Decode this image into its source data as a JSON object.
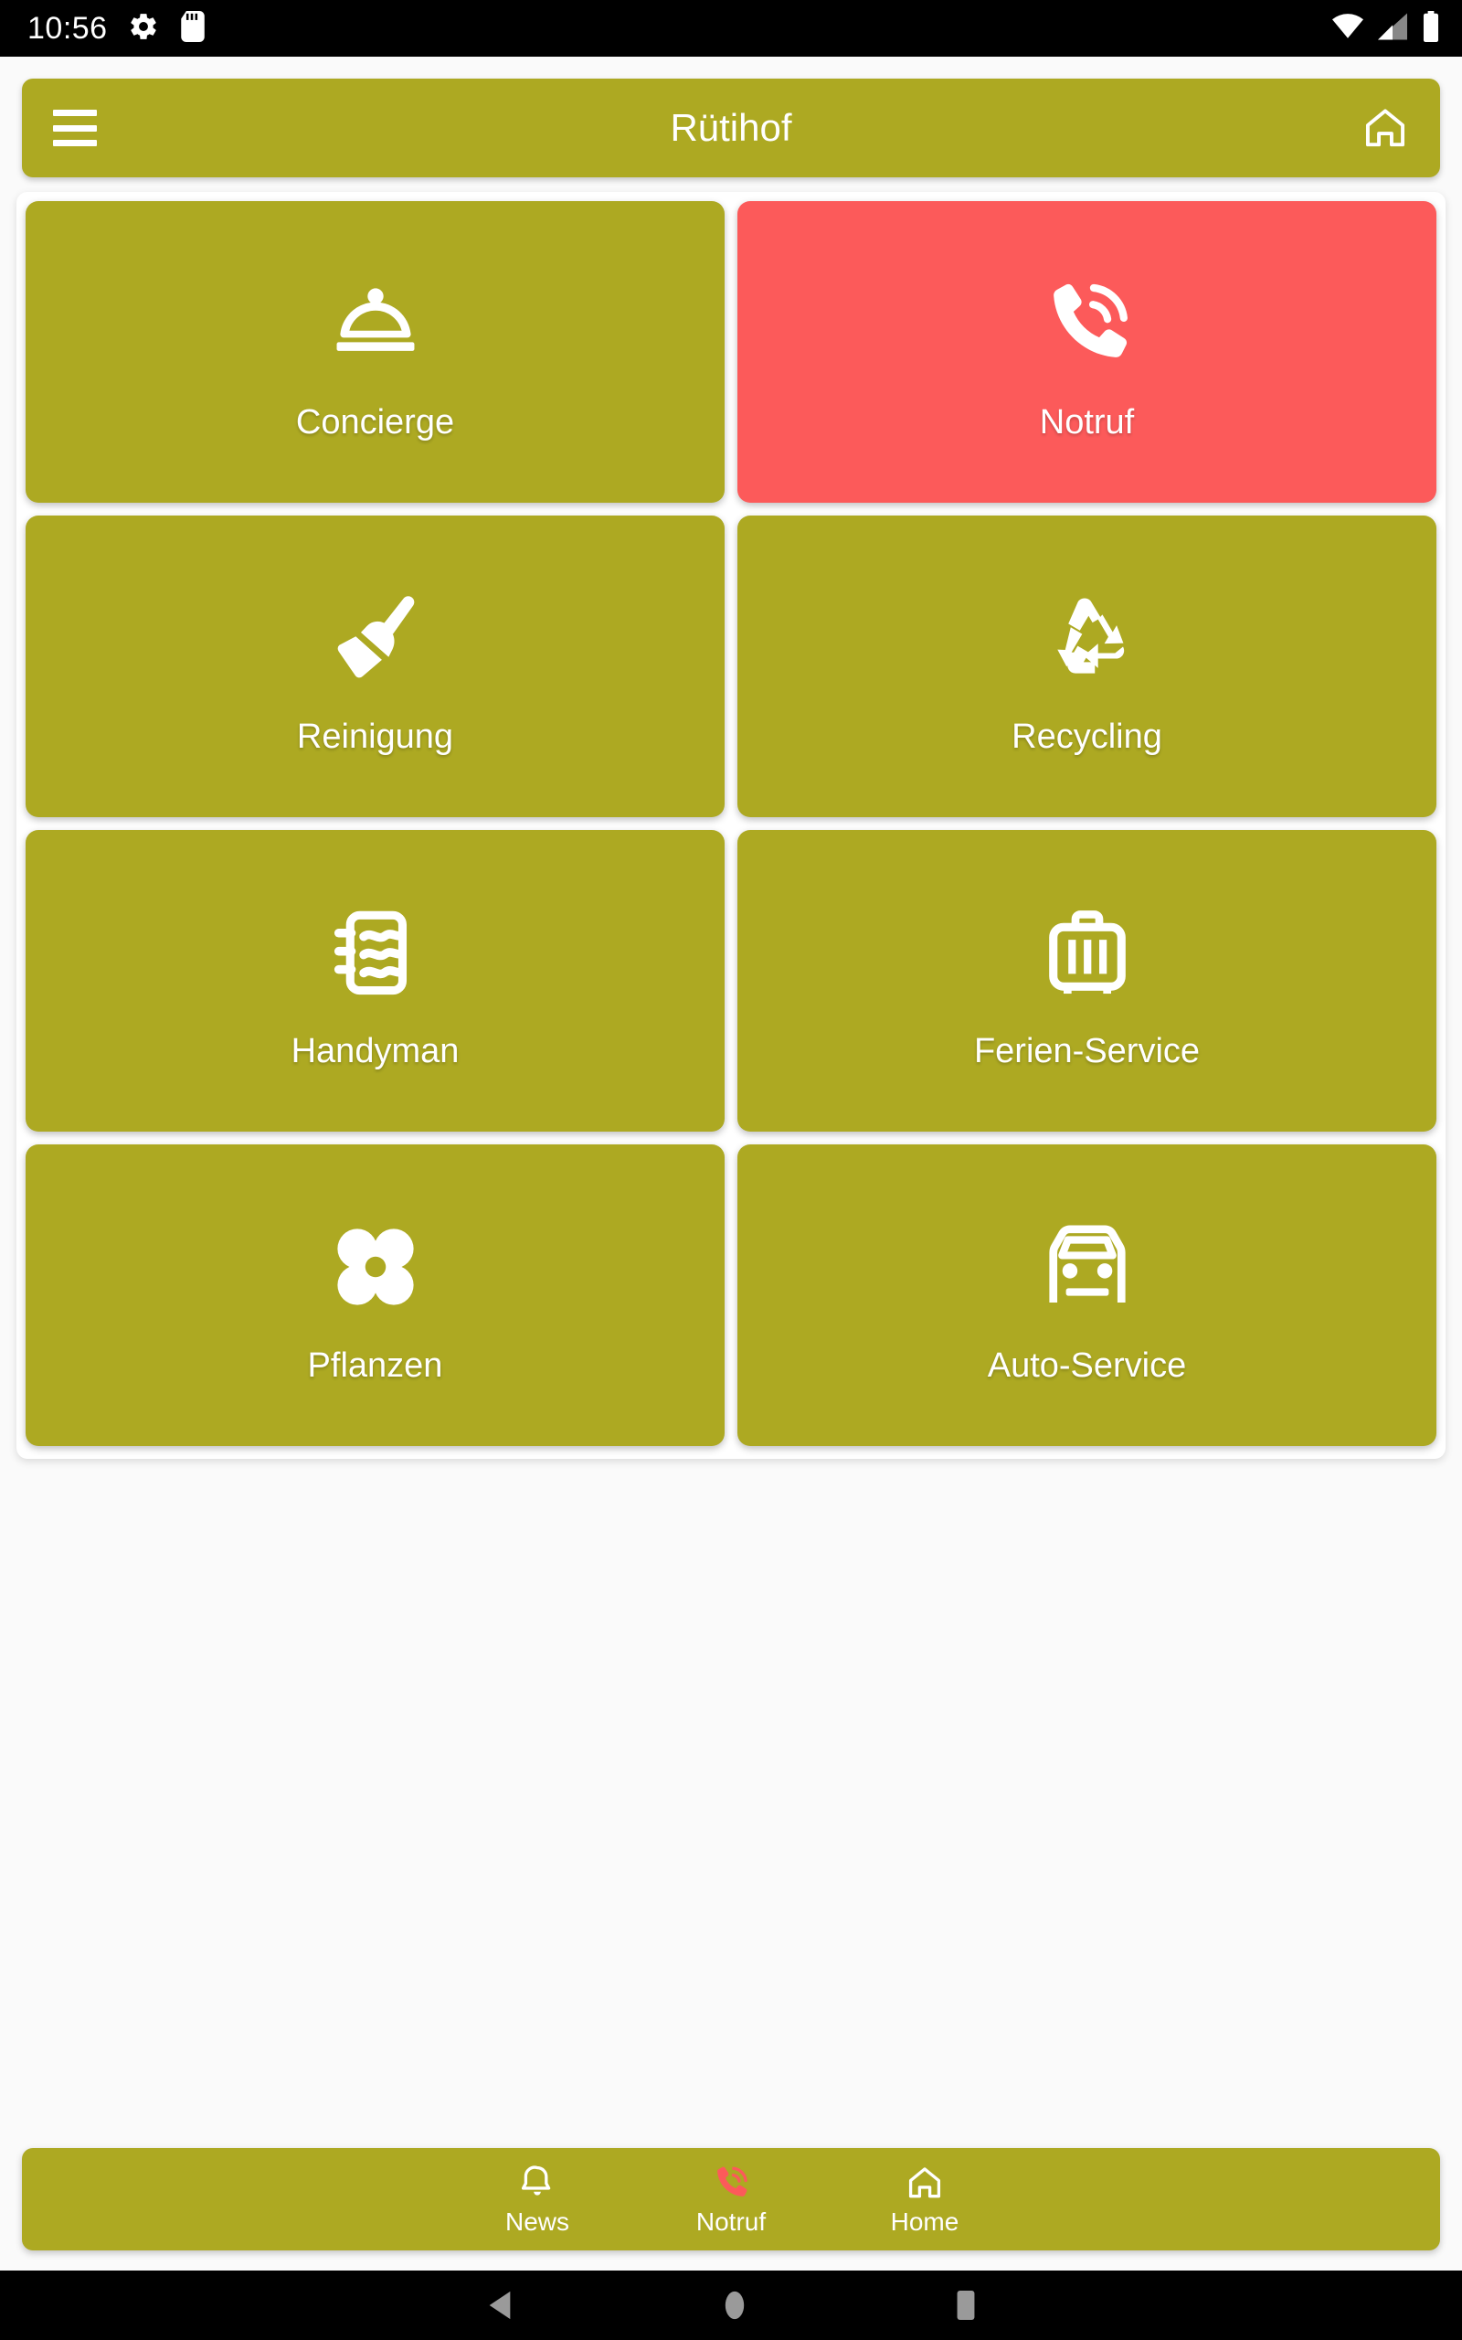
{
  "statusbar": {
    "time": "10:56",
    "left_icons": [
      "gear-icon",
      "sd-card-icon"
    ],
    "right_icons": [
      "wifi-icon",
      "cell-signal-icon",
      "battery-icon"
    ]
  },
  "appbar": {
    "title": "Rütihof",
    "menu_icon": "hamburger-menu-icon",
    "home_icon": "home-icon",
    "background_color": "#ADA922"
  },
  "theme": {
    "primary": "#ADA922",
    "emergency": "#FC5A5A",
    "surface": "#FAFAFA",
    "card": "#FFFFFF",
    "on_primary": "#FFFFFF"
  },
  "tiles": [
    {
      "label": "Concierge",
      "icon": "serving-dome-icon",
      "color": "#ADA922",
      "emergency": false
    },
    {
      "label": "Notruf",
      "icon": "phone-call-icon",
      "color": "#FC5A5A",
      "emergency": true
    },
    {
      "label": "Reinigung",
      "icon": "broom-icon",
      "color": "#ADA922",
      "emergency": false
    },
    {
      "label": "Recycling",
      "icon": "recycling-icon",
      "color": "#ADA922",
      "emergency": false
    },
    {
      "label": "Handyman",
      "icon": "notepad-icon",
      "color": "#ADA922",
      "emergency": false
    },
    {
      "label": "Ferien-Service",
      "icon": "suitcase-icon",
      "color": "#ADA922",
      "emergency": false
    },
    {
      "label": "Pflanzen",
      "icon": "flower-icon",
      "color": "#ADA922",
      "emergency": false
    },
    {
      "label": "Auto-Service",
      "icon": "car-icon",
      "color": "#ADA922",
      "emergency": false
    }
  ],
  "bottom_nav": {
    "items": [
      {
        "label": "News",
        "icon": "bell-icon",
        "color": "#FFFFFF"
      },
      {
        "label": "Notruf",
        "icon": "phone-call-icon",
        "color": "#FC5A5A"
      },
      {
        "label": "Home",
        "icon": "home-icon",
        "color": "#FFFFFF"
      }
    ]
  },
  "system_nav": {
    "back": "back-triangle-icon",
    "home": "home-circle-icon",
    "recents": "recents-square-icon"
  }
}
